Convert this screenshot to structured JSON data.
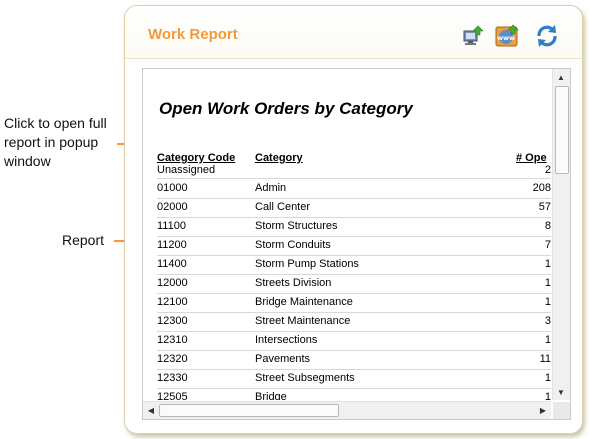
{
  "annotations": {
    "report_link": "Click to open full report in popup window",
    "report": "Report"
  },
  "panel": {
    "title": "Work Report",
    "icons": [
      "export-to-pc-icon",
      "open-in-browser-icon",
      "refresh-icon"
    ]
  },
  "report": {
    "title": "Open Work Orders by Category",
    "columns": [
      "Category Code",
      "Category",
      "# Ope"
    ],
    "rows": [
      {
        "code": "Unassigned",
        "category": "",
        "count": "2"
      },
      {
        "code": "01000",
        "category": "Admin",
        "count": "208"
      },
      {
        "code": "02000",
        "category": "Call Center",
        "count": "57"
      },
      {
        "code": "11100",
        "category": "Storm Structures",
        "count": "8"
      },
      {
        "code": "11200",
        "category": "Storm Conduits",
        "count": "7"
      },
      {
        "code": "11400",
        "category": "Storm Pump Stations",
        "count": "1"
      },
      {
        "code": "12000",
        "category": "Streets Division",
        "count": "1"
      },
      {
        "code": "12100",
        "category": "Bridge Maintenance",
        "count": "1"
      },
      {
        "code": "12300",
        "category": "Street Maintenance",
        "count": "3"
      },
      {
        "code": "12310",
        "category": "Intersections",
        "count": "1"
      },
      {
        "code": "12320",
        "category": "Pavements",
        "count": "11"
      },
      {
        "code": "12330",
        "category": "Street Subsegments",
        "count": "1"
      },
      {
        "code": "12505",
        "category": "Bridge",
        "count": "1"
      }
    ]
  },
  "colors": {
    "accent": "#f39a3c",
    "panel_border": "#d9d2a8"
  }
}
